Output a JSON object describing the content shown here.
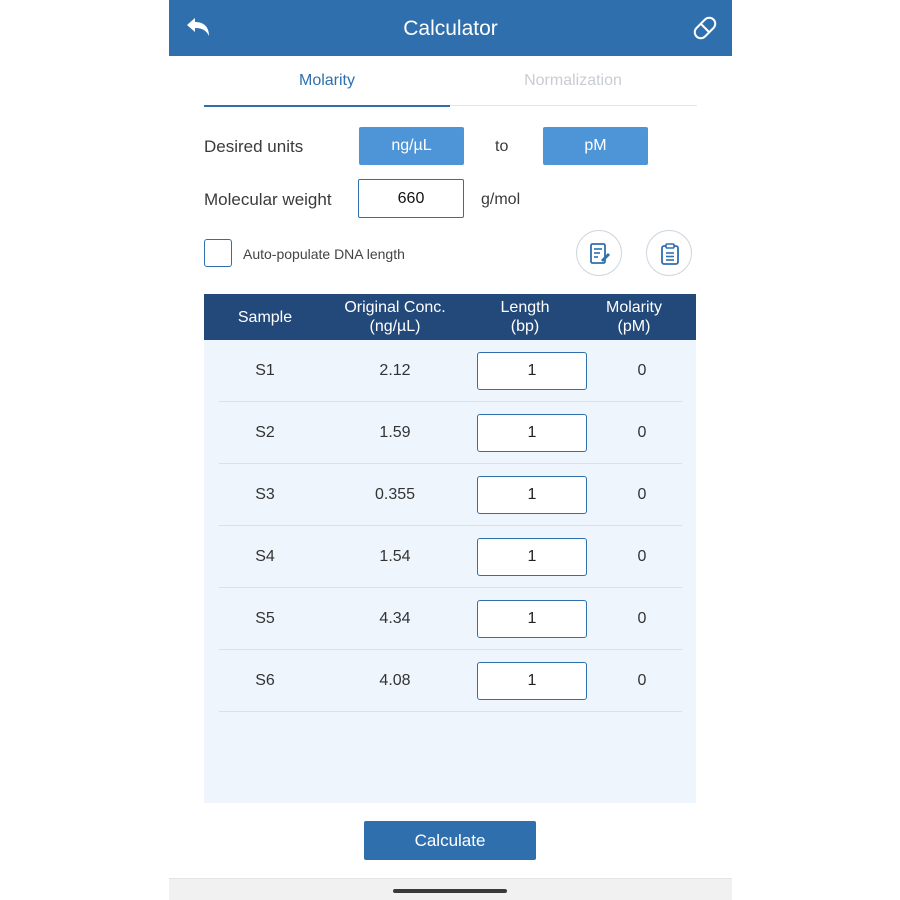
{
  "app_bar": {
    "title": "Calculator"
  },
  "tabs": [
    {
      "label": "Molarity",
      "active": true
    },
    {
      "label": "Normalization",
      "active": false
    }
  ],
  "units": {
    "label": "Desired units",
    "from": "ng/µL",
    "connector": "to",
    "to": "pM"
  },
  "molecular_weight": {
    "label": "Molecular weight",
    "value": "660",
    "unit": "g/mol"
  },
  "auto_populate": {
    "label": "Auto-populate DNA length",
    "checked": false
  },
  "table": {
    "headers": {
      "sample": "Sample",
      "conc": [
        "Original Conc.",
        "(ng/µL)"
      ],
      "length": [
        "Length",
        "(bp)"
      ],
      "molarity": [
        "Molarity",
        "(pM)"
      ]
    },
    "rows": [
      {
        "sample": "S1",
        "conc": "2.12",
        "length": "1",
        "molarity": "0"
      },
      {
        "sample": "S2",
        "conc": "1.59",
        "length": "1",
        "molarity": "0"
      },
      {
        "sample": "S3",
        "conc": "0.355",
        "length": "1",
        "molarity": "0"
      },
      {
        "sample": "S4",
        "conc": "1.54",
        "length": "1",
        "molarity": "0"
      },
      {
        "sample": "S5",
        "conc": "4.34",
        "length": "1",
        "molarity": "0"
      },
      {
        "sample": "S6",
        "conc": "4.08",
        "length": "1",
        "molarity": "0"
      }
    ]
  },
  "calculate_button": "Calculate",
  "colors": {
    "primary": "#2f6fad",
    "unit_button": "#4d95d6",
    "table_header": "#22497a",
    "table_bg": "#eef5fc"
  },
  "icons": {
    "back": "back-arrow-icon",
    "pill": "pill-icon",
    "edit_list": "edit-list-icon",
    "clipboard": "clipboard-icon"
  }
}
